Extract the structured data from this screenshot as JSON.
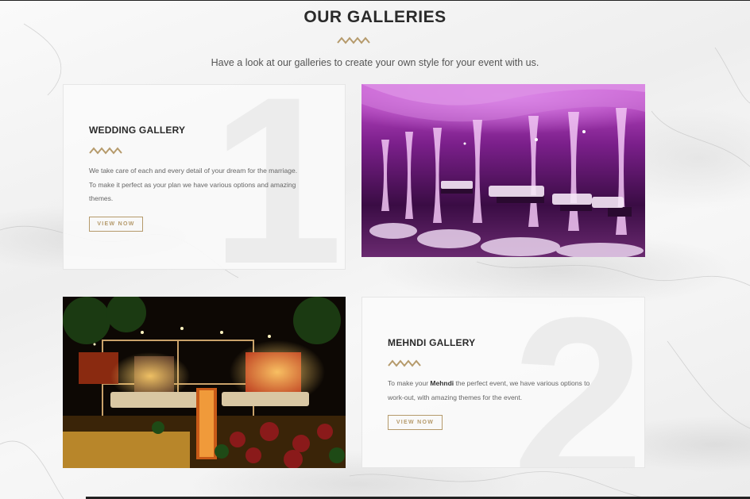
{
  "header": {
    "title": "OUR GALLERIES",
    "subtitle": "Have a look at our galleries to create your own style for your event with us."
  },
  "galleries": [
    {
      "number": "1",
      "title": "WEDDING GALLERY",
      "text": "We take care of each and every detail of your dream for the marriage. To make it perfect as your plan we have various options and amazing themes.",
      "button": "VIEW NOW",
      "image_alt": "wedding venue decorated with purple draped fabric"
    },
    {
      "number": "2",
      "title": "MEHNDI GALLERY",
      "text_before": "To make your ",
      "text_bold": "Mehndi",
      "text_after": " the perfect event, we have various options to work-out, with amazing themes for the event.",
      "button": "VIEW NOW",
      "image_alt": "outdoor mehndi setup at night with warm lights"
    }
  ],
  "colors": {
    "accent": "#b59a6b",
    "text_dark": "#2a2a2a",
    "text_body": "#666666"
  }
}
